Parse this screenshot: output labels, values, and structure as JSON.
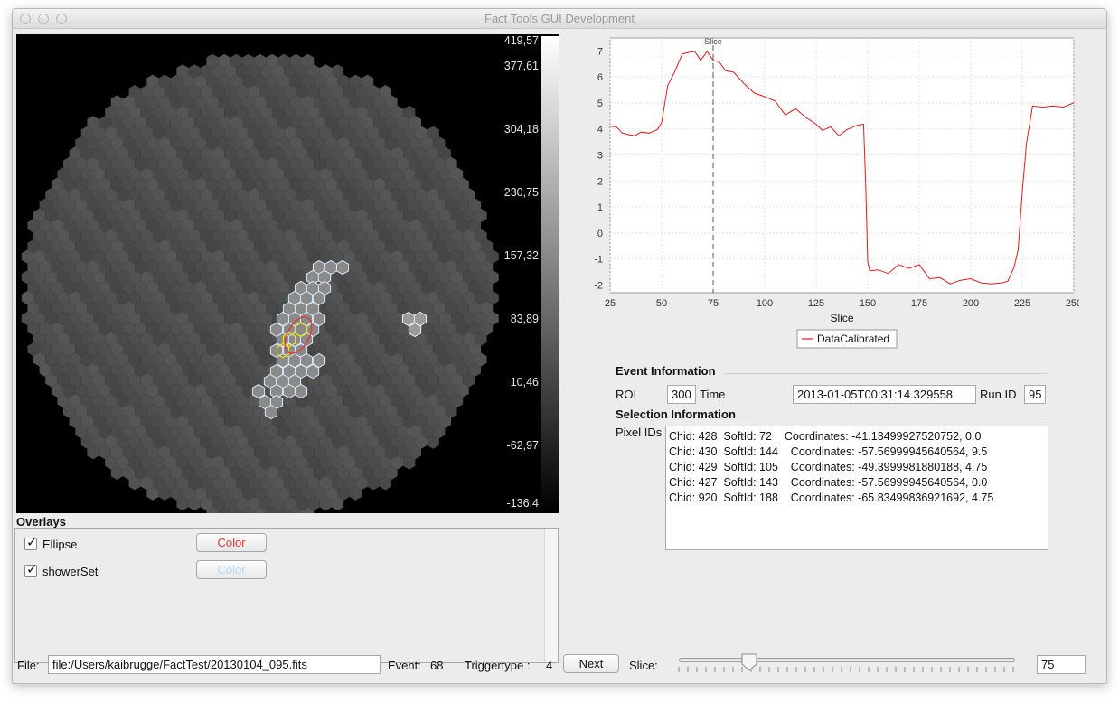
{
  "window": {
    "title": "Fact Tools GUI Development"
  },
  "camera": {
    "colorbar_labels": [
      "419,57",
      "377,61",
      "304,18",
      "230,75",
      "157,32",
      "83,89",
      "10,46",
      "-62,97",
      "-136,4"
    ]
  },
  "overlays": {
    "title": "Overlays",
    "items": [
      {
        "label": "Ellipse",
        "checked": true,
        "button_label": "Color",
        "color": "#e8352e"
      },
      {
        "label": "showerSet",
        "checked": true,
        "button_label": "Color",
        "color": "#b7d6f3"
      }
    ]
  },
  "chart_data": {
    "type": "line",
    "xlabel": "Slice",
    "ylabel": "",
    "xlim": [
      25,
      250
    ],
    "ylim": [
      -2.3,
      7.5
    ],
    "xticks": [
      25,
      50,
      75,
      100,
      125,
      150,
      175,
      200,
      225,
      250
    ],
    "yticks": [
      7,
      6,
      5,
      4,
      3,
      2,
      1,
      0,
      -1,
      -2
    ],
    "grid": true,
    "legend_position": "bottom",
    "marker": {
      "x": 75,
      "label": "Slice"
    },
    "series": [
      {
        "name": "DataCalibrated",
        "color": "#e11b1b",
        "x": [
          25,
          28,
          31,
          34,
          37,
          40,
          44,
          48,
          50,
          53,
          56,
          60,
          63,
          66,
          69,
          72,
          75,
          78,
          81,
          85,
          90,
          95,
          100,
          105,
          110,
          115,
          120,
          125,
          128,
          132,
          136,
          140,
          145,
          148,
          149,
          150,
          151,
          155,
          160,
          165,
          170,
          175,
          180,
          185,
          190,
          195,
          200,
          205,
          210,
          215,
          218,
          221,
          223,
          225,
          227,
          230,
          235,
          240,
          245,
          250
        ],
        "y": [
          4.1,
          4.0,
          3.9,
          3.7,
          3.8,
          3.8,
          3.9,
          3.9,
          4.3,
          5.6,
          6.2,
          6.8,
          7.0,
          6.9,
          6.7,
          6.9,
          6.7,
          6.5,
          6.3,
          6.1,
          5.8,
          5.3,
          5.3,
          5.0,
          4.6,
          4.7,
          4.5,
          4.1,
          4.0,
          4.0,
          3.8,
          3.9,
          4.2,
          4.1,
          2.0,
          -1.2,
          -1.4,
          -1.5,
          -1.5,
          -1.3,
          -1.3,
          -1.3,
          -1.7,
          -1.8,
          -1.9,
          -1.9,
          -1.7,
          -2.0,
          -1.9,
          -2.0,
          -1.8,
          -1.4,
          -0.6,
          1.5,
          3.5,
          4.8,
          4.9,
          4.8,
          4.9,
          5.0
        ]
      }
    ]
  },
  "event_info": {
    "title": "Event Information",
    "roi_label": "ROI",
    "roi_value": "300",
    "time_label": "Time",
    "time_value": "2013-01-05T00:31:14.329558",
    "run_label": "Run ID",
    "run_value": "95"
  },
  "selection_info": {
    "title": "Selection Information",
    "pixel_ids_label": "Pixel IDs",
    "pixels": [
      "Chid: 428  SoftId: 72    Coordinates: -41.13499927520752, 0.0",
      "Chid: 430  SoftId: 144    Coordinates: -57.56999945640564, 9.5",
      "Chid: 429  SoftId: 105    Coordinates: -49.3999981880188, 4.75",
      "Chid: 427  SoftId: 143    Coordinates: -57.56999945640564, 0.0",
      "Chid: 920  SoftId: 188    Coordinates: -65.83499836921692, 4.75"
    ]
  },
  "bottom": {
    "file_label": "File:",
    "file_value": "file:/Users/kaibrugge/FactTest/20130104_095.fits",
    "event_label": "Event:",
    "event_value": "68",
    "trigger_label": "Triggertype :",
    "trigger_value": "4",
    "next_label": "Next",
    "slice_label": "Slice:",
    "slice_value": "75",
    "slice_fraction": 0.21
  }
}
